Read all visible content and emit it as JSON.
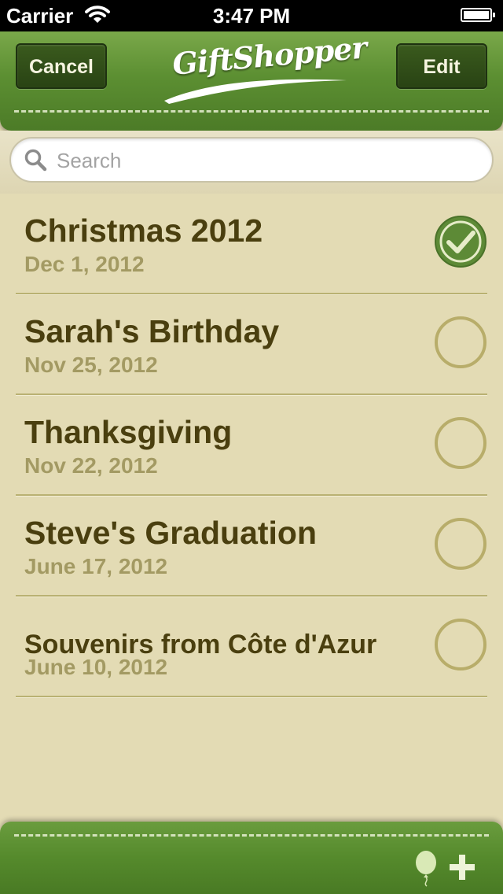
{
  "status_bar": {
    "carrier": "Carrier",
    "time": "3:47 PM",
    "icons": [
      "wifi-icon",
      "battery-icon"
    ]
  },
  "nav_bar": {
    "cancel_label": "Cancel",
    "logo_text": "GiftShopper",
    "edit_label": "Edit"
  },
  "search": {
    "placeholder": "Search",
    "value": ""
  },
  "occasions": [
    {
      "title": "Christmas 2012",
      "date": "Dec 1, 2012",
      "checked": true
    },
    {
      "title": "Sarah's Birthday",
      "date": "Nov 25, 2012",
      "checked": false
    },
    {
      "title": "Thanksgiving",
      "date": "Nov 22, 2012",
      "checked": false
    },
    {
      "title": "Steve's Graduation",
      "date": "June 17, 2012",
      "checked": false
    },
    {
      "title": "Souvenirs from Côte d'Azur",
      "date": "June 10, 2012",
      "checked": false
    }
  ],
  "bottom_bar": {
    "icons": [
      "balloon-icon",
      "add-icon"
    ]
  },
  "colors": {
    "leather_green": "#5c8f32",
    "list_background": "#e3dbb4",
    "title_text": "#4a3f0f",
    "date_text": "#a39a63",
    "check_green": "#5d8a36",
    "check_outline": "#b8ad6a"
  }
}
